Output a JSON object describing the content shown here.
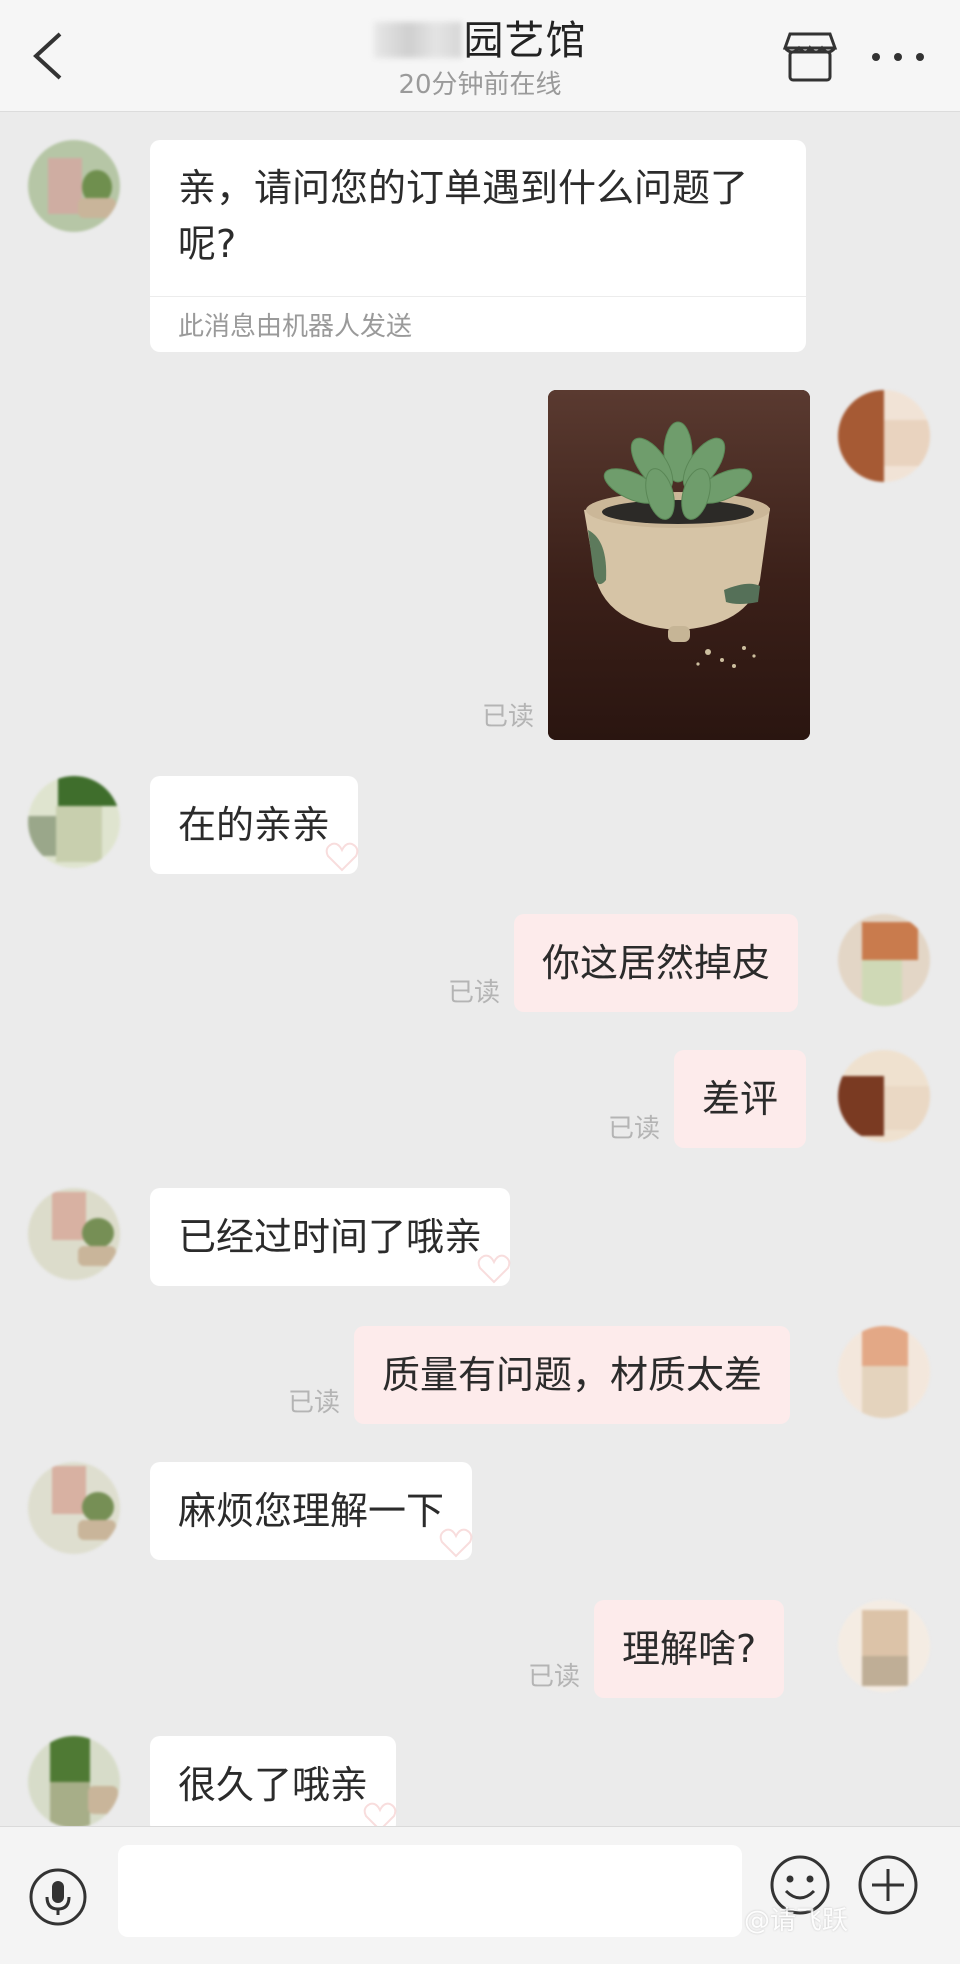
{
  "header": {
    "shop_name_visible": "园艺馆",
    "status": "20分钟前在线"
  },
  "messages": [
    {
      "side": "left",
      "type": "card",
      "text": "亲，请问您的订单遇到什么问题了呢?",
      "note": "此消息由机器人发送"
    },
    {
      "side": "right",
      "type": "image",
      "read": "已读"
    },
    {
      "side": "left",
      "type": "text",
      "text": "在的亲亲"
    },
    {
      "side": "right",
      "type": "text",
      "text": "你这居然掉皮",
      "read": "已读"
    },
    {
      "side": "right",
      "type": "text",
      "text": "差评",
      "read": "已读"
    },
    {
      "side": "left",
      "type": "text",
      "text": "已经过时间了哦亲"
    },
    {
      "side": "right",
      "type": "text",
      "text": "质量有问题，材质太差",
      "read": "已读"
    },
    {
      "side": "left",
      "type": "text",
      "text": "麻烦您理解一下"
    },
    {
      "side": "right",
      "type": "text",
      "text": "理解啥?",
      "read": "已读"
    },
    {
      "side": "left",
      "type": "text",
      "text": "很久了哦亲"
    }
  ],
  "input": {
    "value": "",
    "placeholder": ""
  },
  "icons": {
    "back": "chevron-left-icon",
    "store": "store-icon",
    "more": "more-dots-icon",
    "voice": "microphone-icon",
    "emoji": "smiley-icon",
    "plus": "plus-circle-icon"
  },
  "watermark": "@请飞跃",
  "colors": {
    "background": "#ebebeb",
    "bubble_left": "#ffffff",
    "bubble_right": "#fdebeb",
    "read_text": "#b4b4b4"
  }
}
